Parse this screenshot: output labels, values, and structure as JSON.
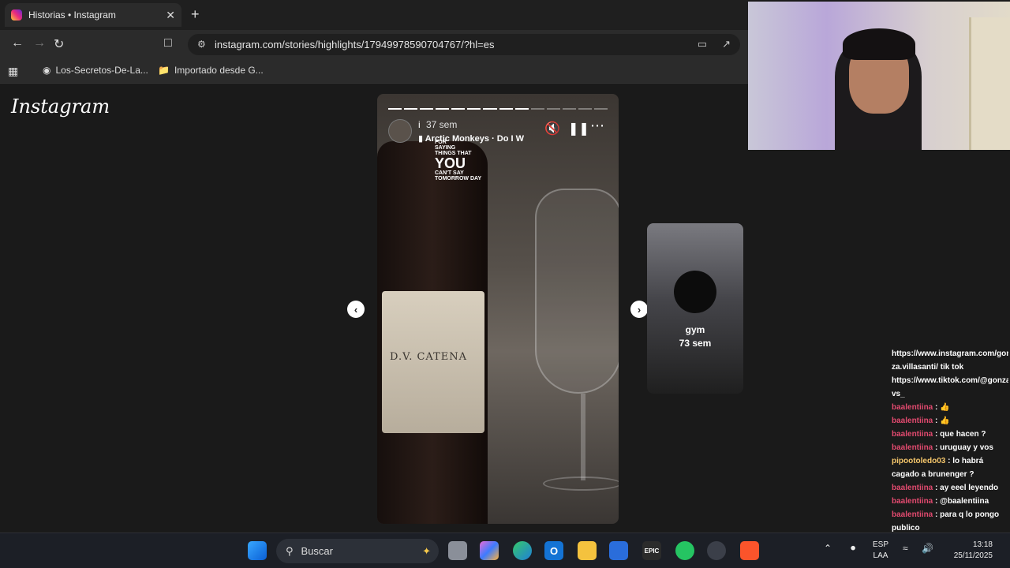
{
  "browser": {
    "tab_title": "Historias • Instagram",
    "tab_close": "✕",
    "new_tab": "+",
    "url": "instagram.com/stories/highlights/17949978590704767/?hl=es",
    "bookmarks": [
      "Los-Secretos-De-La...",
      "Importado desde G..."
    ]
  },
  "page": {
    "logo": "Instagram",
    "story": {
      "progress_total": 14,
      "progress_done": 9,
      "username": "i",
      "time": "37 sem",
      "music": "Arctic Monkeys · Do I W",
      "overlay_lines": [
        "FOR",
        "SAYING",
        "THINGS THAT",
        "YOU",
        "CAN'T SAY",
        "TOMORROW DAY"
      ],
      "label_text": "D.V. CATENA"
    },
    "next": {
      "title": "gym",
      "time": "73 sem"
    },
    "prev_arrow": "‹",
    "next_arrow": "›"
  },
  "chat": {
    "lines": [
      {
        "user": "",
        "text": "https://www.instagram.com/gon"
      },
      {
        "user": "",
        "text": "za.villasanti/ tik tok"
      },
      {
        "user": "",
        "text": "https://www.tiktok.com/@gonza"
      },
      {
        "user": "",
        "text": "vs_"
      },
      {
        "user": "baalentiina",
        "text": " : 👍"
      },
      {
        "user": "baalentiina",
        "text": " : 👍"
      },
      {
        "user": "baalentiina",
        "text": " : que hacen ?"
      },
      {
        "user": "baalentiina",
        "text": " : uruguay y vos"
      },
      {
        "user": "pipootoledo03",
        "text": " : lo habrá"
      },
      {
        "user": "",
        "text": "cagado a brunenger ?"
      },
      {
        "user": "baalentiina",
        "text": " : ay eeel leyendo"
      },
      {
        "user": "baalentiina",
        "text": " : @baalentiina"
      },
      {
        "user": "baalentiina",
        "text": " : para q lo pongo"
      },
      {
        "user": "",
        "text": "publico"
      }
    ]
  },
  "taskbar": {
    "search_placeholder": "Buscar",
    "lang": "ESP",
    "layout": "LAA",
    "time": "13:18",
    "date": "25/11/2025"
  },
  "colors": {
    "chat_user": "#e24a6f",
    "chat_user_alt": "#f6c76b",
    "page_bg": "#1a1a1a"
  }
}
